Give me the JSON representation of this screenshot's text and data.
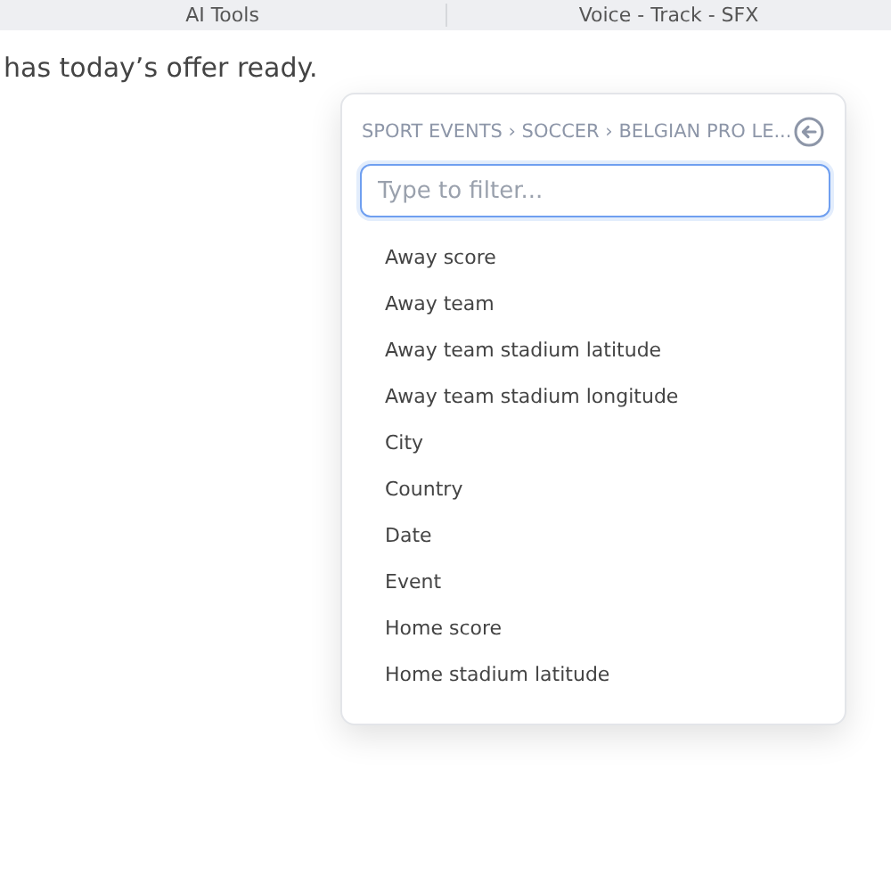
{
  "top_tabs": [
    {
      "label": "AI Tools"
    },
    {
      "label": "Voice - Track - SFX"
    }
  ],
  "message": "has today’s offer ready.",
  "picker": {
    "breadcrumb": "SPORT EVENTS › SOCCER › BELGIAN PRO LE...",
    "filter": {
      "placeholder": "Type to filter..."
    },
    "items": [
      "Away score",
      "Away team",
      "Away team stadium latitude",
      "Away team stadium longitude",
      "City",
      "Country",
      "Date",
      "Event",
      "Home score",
      "Home stadium latitude"
    ]
  }
}
